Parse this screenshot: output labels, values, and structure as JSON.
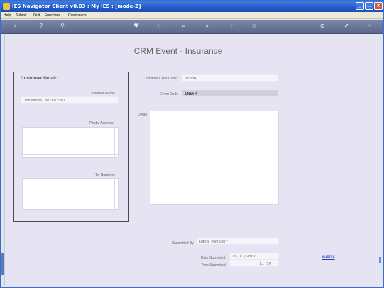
{
  "window": {
    "title": "IES Navigator Client v8.03 : My IES :      [mode-Z]"
  },
  "menu": [
    "Help",
    "Submit",
    "Quit",
    "Functions",
    "Commands"
  ],
  "toolbar": {
    "icons": [
      "back-arrow-icon",
      "help-icon",
      "search-icon",
      "heart-icon",
      "refresh-icon",
      "rewind-icon",
      "fast-forward-icon",
      "up-arrow-icon",
      "list-icon",
      "globe-icon",
      "check-icon",
      "close-icon"
    ],
    "glyphs": {
      "back": "⟵",
      "help": "?",
      "search": "⚲",
      "heart": "♥",
      "refresh": "↻",
      "rewind": "«",
      "forward": "»",
      "up": "⇧",
      "list": "≣",
      "globe": "⊕",
      "check": "✔",
      "close": "✕"
    }
  },
  "page": {
    "title": "CRM Event  - Insurance"
  },
  "customer_detail": {
    "heading": "Customer Detail :",
    "name_label": "Customer Name",
    "name_value": "Johannes Herkorrel",
    "address_label": "Postal Address",
    "tel_label": "Tel Numbers"
  },
  "form": {
    "crm_code_label": "Customer CRM Code",
    "crm_code_value": "00034",
    "event_code_label": "Event Code",
    "event_code_value": "INS04",
    "detail_label": "Detail",
    "submitted_by_label": "Submitted By",
    "submitted_by_value": "Data Manager",
    "date_label": "Date Submitted",
    "date_value": "19/11/2007",
    "time_label": "Time Submitted",
    "time_value": "11:50",
    "submit_link": "Submit"
  },
  "colors": {
    "titlebar": "#2458c8",
    "toolbar": "#6a7496",
    "content": "#e6e4f2",
    "link": "#2040c0"
  }
}
